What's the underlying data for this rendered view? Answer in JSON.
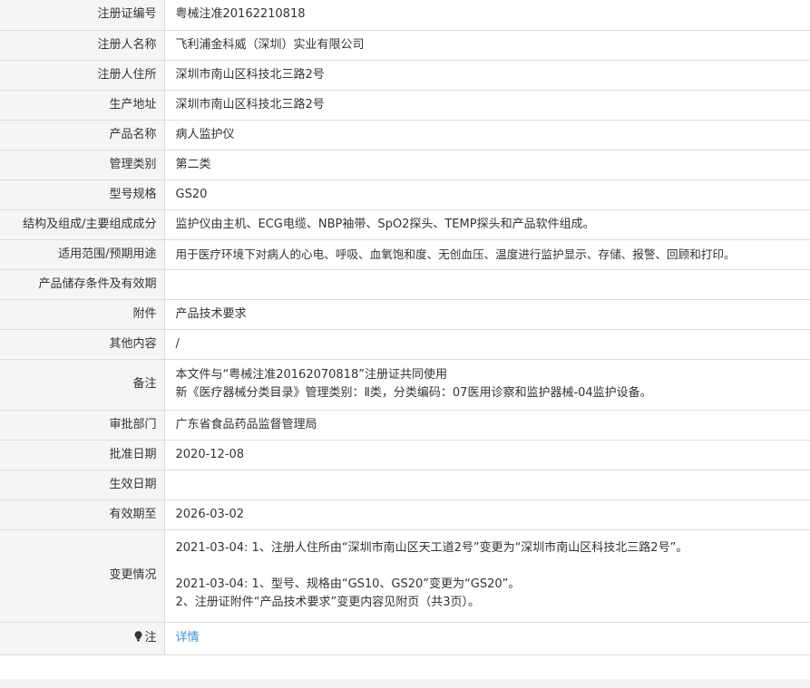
{
  "rows": [
    {
      "label": "注册证编号",
      "value": "粤械注准20162210818"
    },
    {
      "label": "注册人名称",
      "value": "飞利浦金科威（深圳）实业有限公司"
    },
    {
      "label": "注册人住所",
      "value": "深圳市南山区科技北三路2号"
    },
    {
      "label": "生产地址",
      "value": "深圳市南山区科技北三路2号"
    },
    {
      "label": "产品名称",
      "value": "病人监护仪"
    },
    {
      "label": "管理类别",
      "value": "第二类"
    },
    {
      "label": "型号规格",
      "value": "GS20"
    },
    {
      "label": "结构及组成/主要组成成分",
      "value": "监护仪由主机、ECG电缆、NBP袖带、SpO2探头、TEMP探头和产品软件组成。"
    },
    {
      "label": "适用范围/预期用途",
      "value": "用于医疗环境下对病人的心电、呼吸、血氧饱和度、无创血压、温度进行监护显示、存储、报警、回顾和打印。"
    },
    {
      "label": "产品储存条件及有效期",
      "value": ""
    },
    {
      "label": "附件",
      "value": "产品技术要求"
    },
    {
      "label": "其他内容",
      "value": "/"
    }
  ],
  "remark": {
    "label": "备注",
    "line1": "本文件与“粤械注准20162070818”注册证共同使用",
    "line2": "新《医疗器械分类目录》管理类别：Ⅱ类，分类编码：07医用诊察和监护器械-04监护设备。"
  },
  "rows2": [
    {
      "label": "审批部门",
      "value": "广东省食品药品监督管理局"
    },
    {
      "label": "批准日期",
      "value": "2020-12-08"
    },
    {
      "label": "生效日期",
      "value": ""
    },
    {
      "label": "有效期至",
      "value": "2026-03-02"
    }
  ],
  "changes": {
    "label": "变更情况",
    "line1": "2021-03-04: 1、注册人住所由“深圳市南山区天工道2号”变更为“深圳市南山区科技北三路2号”。",
    "line2": "2021-03-04: 1、型号、规格由“GS10、GS20”变更为“GS20”。",
    "line3": "2、注册证附件“产品技术要求”变更内容见附页（共3页）。"
  },
  "note": {
    "icon": "lightbulb-icon",
    "label": "注",
    "link": "详情"
  },
  "colors": {
    "label_bg": "#f5f5f5",
    "border": "#dcdcdc",
    "text": "#333333",
    "link": "#3b8fd6"
  }
}
